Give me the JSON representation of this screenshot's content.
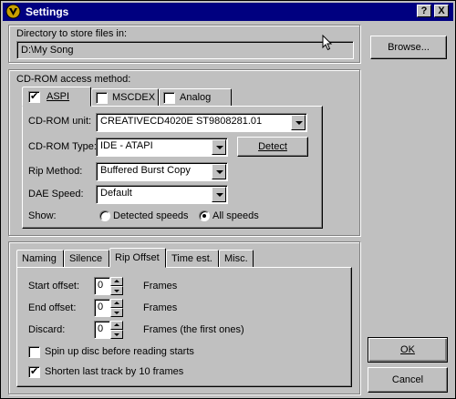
{
  "window": {
    "title": "Settings",
    "help_glyph": "?",
    "close_glyph": "X"
  },
  "directory": {
    "label": "Directory to store files in:",
    "value": "D:\\My Song",
    "browse_label": "Browse..."
  },
  "cdrom": {
    "group_label": "CD-ROM access method:",
    "tabs": [
      "ASPI",
      "MSCDEX",
      "Analog"
    ],
    "unit_label": "CD-ROM unit:",
    "unit_value": "CREATIVECD4020E ST9808281.01",
    "type_label": "CD-ROM Type:",
    "type_value": "IDE  - ATAPI",
    "detect_label": "Detect",
    "rip_label": "Rip Method:",
    "rip_value": "Buffered Burst Copy",
    "dae_label": "DAE Speed:",
    "dae_value": "Default",
    "show_label": "Show:",
    "show_detected": "Detected speeds",
    "show_all": "All speeds"
  },
  "lower": {
    "tabs": [
      "Naming",
      "Silence",
      "Rip Offset",
      "Time est.",
      "Misc."
    ],
    "start_label": "Start offset:",
    "start_value": "0",
    "start_unit": "Frames",
    "end_label": "End offset:",
    "end_value": "0",
    "end_unit": "Frames",
    "discard_label": "Discard:",
    "discard_value": "0",
    "discard_unit": "Frames (the first ones)",
    "spinup_label": "Spin up disc before reading starts",
    "shorten_label": "Shorten last track by 10 frames"
  },
  "buttons": {
    "ok": "OK",
    "cancel": "Cancel"
  },
  "icons": {
    "title_icon": "app-shield-icon",
    "cursor": "mouse-pointer-icon"
  },
  "colors": {
    "titlebar": "#000080",
    "face": "#c0c0c0"
  }
}
